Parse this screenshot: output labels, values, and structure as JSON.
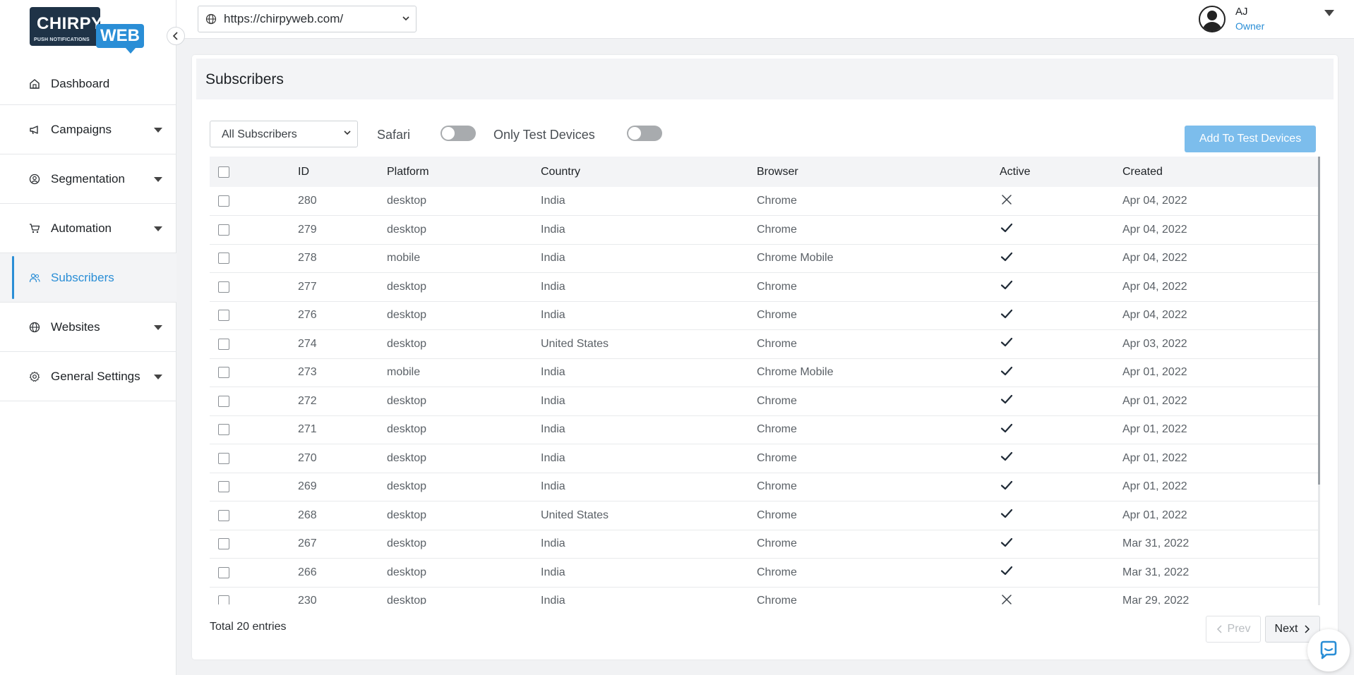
{
  "brand": {
    "logo_main": "CHIRPY",
    "logo_sub": "PUSH NOTIFICATIONS",
    "logo_web": "WEB"
  },
  "sidebar": {
    "items": [
      {
        "label": "Dashboard",
        "icon": "home-icon",
        "has_caret": false,
        "active": false
      },
      {
        "label": "Campaigns",
        "icon": "megaphone-icon",
        "has_caret": true,
        "active": false
      },
      {
        "label": "Segmentation",
        "icon": "user-circle-icon",
        "has_caret": true,
        "active": false
      },
      {
        "label": "Automation",
        "icon": "cart-icon",
        "has_caret": true,
        "active": false
      },
      {
        "label": "Subscribers",
        "icon": "users-icon",
        "has_caret": false,
        "active": true
      },
      {
        "label": "Websites",
        "icon": "globe-icon",
        "has_caret": true,
        "active": false
      },
      {
        "label": "General Settings",
        "icon": "gear-icon",
        "has_caret": true,
        "active": false
      }
    ]
  },
  "topbar": {
    "site_url": "https://chirpyweb.com/",
    "user_name": "AJ",
    "user_role": "Owner"
  },
  "page": {
    "title": "Subscribers",
    "filter_selected": "All Subscribers",
    "safari_label": "Safari",
    "safari_on": false,
    "test_devices_label": "Only Test Devices",
    "test_devices_on": false,
    "add_button": "Add To Test Devices",
    "total_text": "Total 20 entries",
    "prev_label": "Prev",
    "next_label": "Next"
  },
  "table": {
    "columns": [
      "ID",
      "Platform",
      "Country",
      "Browser",
      "Active",
      "Created"
    ],
    "rows": [
      {
        "id": "280",
        "platform": "desktop",
        "country": "India",
        "browser": "Chrome",
        "active": false,
        "created": "Apr 04, 2022"
      },
      {
        "id": "279",
        "platform": "desktop",
        "country": "India",
        "browser": "Chrome",
        "active": true,
        "created": "Apr 04, 2022"
      },
      {
        "id": "278",
        "platform": "mobile",
        "country": "India",
        "browser": "Chrome Mobile",
        "active": true,
        "created": "Apr 04, 2022"
      },
      {
        "id": "277",
        "platform": "desktop",
        "country": "India",
        "browser": "Chrome",
        "active": true,
        "created": "Apr 04, 2022"
      },
      {
        "id": "276",
        "platform": "desktop",
        "country": "India",
        "browser": "Chrome",
        "active": true,
        "created": "Apr 04, 2022"
      },
      {
        "id": "274",
        "platform": "desktop",
        "country": "United States",
        "browser": "Chrome",
        "active": true,
        "created": "Apr 03, 2022"
      },
      {
        "id": "273",
        "platform": "mobile",
        "country": "India",
        "browser": "Chrome Mobile",
        "active": true,
        "created": "Apr 01, 2022"
      },
      {
        "id": "272",
        "platform": "desktop",
        "country": "India",
        "browser": "Chrome",
        "active": true,
        "created": "Apr 01, 2022"
      },
      {
        "id": "271",
        "platform": "desktop",
        "country": "India",
        "browser": "Chrome",
        "active": true,
        "created": "Apr 01, 2022"
      },
      {
        "id": "270",
        "platform": "desktop",
        "country": "India",
        "browser": "Chrome",
        "active": true,
        "created": "Apr 01, 2022"
      },
      {
        "id": "269",
        "platform": "desktop",
        "country": "India",
        "browser": "Chrome",
        "active": true,
        "created": "Apr 01, 2022"
      },
      {
        "id": "268",
        "platform": "desktop",
        "country": "United States",
        "browser": "Chrome",
        "active": true,
        "created": "Apr 01, 2022"
      },
      {
        "id": "267",
        "platform": "desktop",
        "country": "India",
        "browser": "Chrome",
        "active": true,
        "created": "Mar 31, 2022"
      },
      {
        "id": "266",
        "platform": "desktop",
        "country": "India",
        "browser": "Chrome",
        "active": true,
        "created": "Mar 31, 2022"
      },
      {
        "id": "230",
        "platform": "desktop",
        "country": "India",
        "browser": "Chrome",
        "active": false,
        "created": "Mar 29, 2022"
      }
    ]
  },
  "colors": {
    "accent": "#2a8ed6",
    "add_button_bg": "#7cbdec",
    "toggle_off": "#a8abae"
  }
}
